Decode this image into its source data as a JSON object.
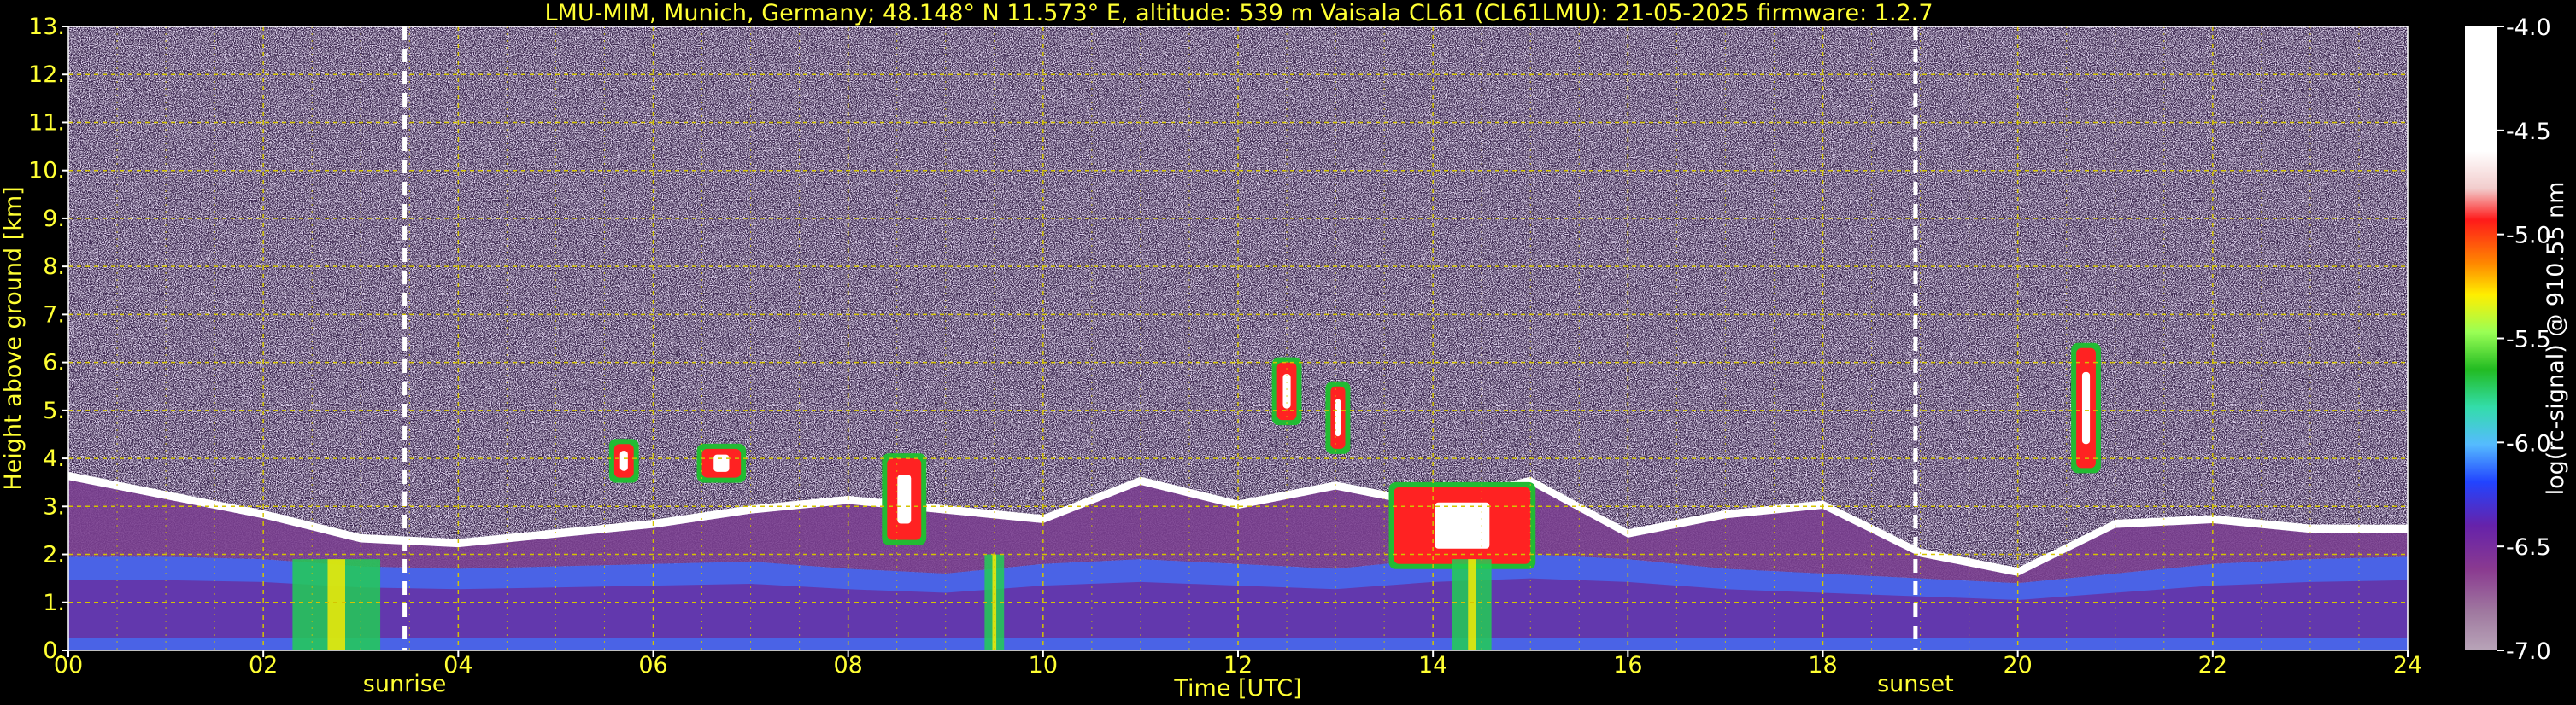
{
  "chart_data": {
    "type": "heatmap",
    "title": "LMU-MIM, Munich, Germany; 48.148° N 11.573° E, altitude: 539 m    Vaisala CL61 (CL61LMU): 21-05-2025    firmware: 1.2.7",
    "xlabel": "Time [UTC]",
    "ylabel": "Height above ground [km]",
    "xlim": [
      0,
      24
    ],
    "ylim": [
      0,
      13
    ],
    "grid": true,
    "x_ticks": [
      "00",
      "02",
      "04",
      "06",
      "08",
      "10",
      "12",
      "14",
      "16",
      "18",
      "20",
      "22",
      "24"
    ],
    "y_ticks": [
      "0.",
      "1.",
      "2.",
      "3.",
      "4.",
      "5.",
      "6.",
      "7.",
      "8.",
      "9.",
      "10.",
      "11.",
      "12.",
      "13."
    ],
    "markers": [
      {
        "label": "sunrise",
        "time": 3.45
      },
      {
        "label": "sunset",
        "time": 18.95
      }
    ],
    "colorbar": {
      "label": "log(rc-signal) @ 910.55 nm",
      "range": [
        -7.0,
        -4.0
      ],
      "ticks": [
        "-4.0",
        "-4.5",
        "-5.0",
        "-5.5",
        "-6.0",
        "-6.5",
        "-7.0"
      ]
    },
    "features": [
      {
        "kind": "boundary_layer",
        "times": [
          0,
          1,
          2,
          3,
          4,
          5,
          6,
          7,
          8,
          9,
          10,
          11,
          12,
          13,
          14,
          15,
          16,
          17,
          18,
          19,
          20,
          21,
          22,
          23,
          24
        ],
        "heights": [
          1.95,
          1.95,
          1.9,
          1.75,
          1.7,
          1.75,
          1.8,
          1.85,
          1.7,
          1.6,
          1.8,
          1.9,
          1.8,
          1.7,
          1.9,
          2.0,
          1.9,
          1.7,
          1.6,
          1.5,
          1.4,
          1.6,
          1.8,
          1.9,
          1.95
        ]
      },
      {
        "kind": "aerosol_layer_top",
        "times": [
          0,
          1,
          2,
          3,
          4,
          5,
          6,
          7,
          8,
          9,
          10,
          11,
          12,
          13,
          14,
          15,
          16,
          17,
          18,
          19,
          20,
          21,
          22,
          23,
          24
        ],
        "heights": [
          3.6,
          3.2,
          2.8,
          2.3,
          2.2,
          2.4,
          2.6,
          2.9,
          3.1,
          2.9,
          2.7,
          3.5,
          3.0,
          3.4,
          3.0,
          3.5,
          2.4,
          2.8,
          3.0,
          2.0,
          1.6,
          2.6,
          2.7,
          2.5,
          2.5
        ]
      },
      {
        "kind": "cloud",
        "t0": 12.4,
        "t1": 12.6,
        "h0": 4.8,
        "h1": 6.0
      },
      {
        "kind": "cloud",
        "t0": 12.95,
        "t1": 13.1,
        "h0": 4.2,
        "h1": 5.5
      },
      {
        "kind": "cloud",
        "t0": 13.6,
        "t1": 15.0,
        "h0": 1.8,
        "h1": 3.4
      },
      {
        "kind": "cloud",
        "t0": 8.4,
        "t1": 8.75,
        "h0": 2.3,
        "h1": 4.0
      },
      {
        "kind": "cloud",
        "t0": 5.6,
        "t1": 5.8,
        "h0": 3.6,
        "h1": 4.3
      },
      {
        "kind": "cloud",
        "t0": 6.5,
        "t1": 6.9,
        "h0": 3.6,
        "h1": 4.2
      },
      {
        "kind": "cloud",
        "t0": 20.6,
        "t1": 20.8,
        "h0": 3.8,
        "h1": 6.3
      },
      {
        "kind": "precipitation",
        "t0": 14.2,
        "t1": 14.6,
        "h0": 0,
        "h1": 1.9
      },
      {
        "kind": "precipitation",
        "t0": 9.4,
        "t1": 9.6,
        "h0": 0,
        "h1": 2.0
      },
      {
        "kind": "precipitation",
        "t0": 2.3,
        "t1": 3.2,
        "h0": 0,
        "h1": 1.9
      }
    ]
  }
}
